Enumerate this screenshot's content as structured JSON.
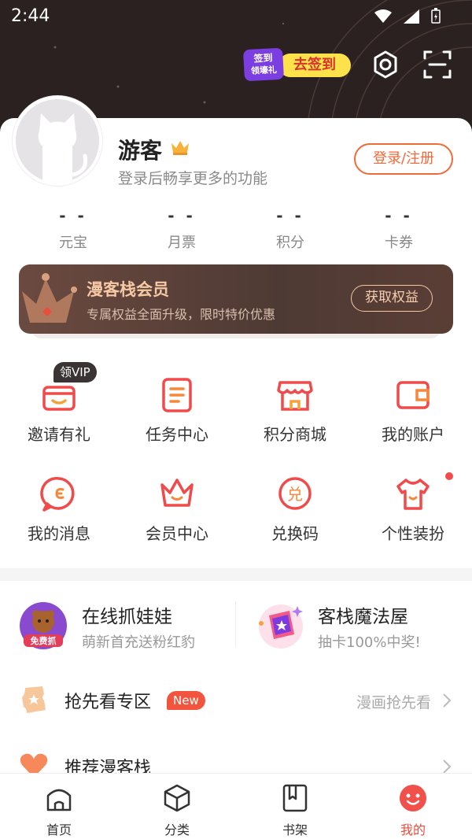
{
  "status_bar": {
    "time": "2:44"
  },
  "header": {
    "checkin_badge_line1": "签到",
    "checkin_badge_line2": "领壕礼",
    "checkin_button": "去签到"
  },
  "profile": {
    "username": "游客",
    "subtitle": "登录后畅享更多的功能",
    "login_button": "登录/注册"
  },
  "stats": [
    {
      "value": "- -",
      "label": "元宝"
    },
    {
      "value": "- -",
      "label": "月票"
    },
    {
      "value": "- -",
      "label": "积分"
    },
    {
      "value": "- -",
      "label": "卡券"
    }
  ],
  "vip_banner": {
    "title": "漫客栈会员",
    "description": "专属权益全面升级，限时特价优惠",
    "button": "获取权益"
  },
  "grid": {
    "row1": [
      {
        "label": "邀请有礼",
        "icon": "gift-box-icon",
        "tag": "领VIP"
      },
      {
        "label": "任务中心",
        "icon": "clipboard-icon"
      },
      {
        "label": "积分商城",
        "icon": "shop-icon"
      },
      {
        "label": "我的账户",
        "icon": "wallet-icon"
      }
    ],
    "row2": [
      {
        "label": "我的消息",
        "icon": "message-icon"
      },
      {
        "label": "会员中心",
        "icon": "crown-icon"
      },
      {
        "label": "兑换码",
        "icon": "redeem-icon",
        "glyph": "兑"
      },
      {
        "label": "个性装扮",
        "icon": "tshirt-icon"
      }
    ]
  },
  "promos": [
    {
      "title": "在线抓娃娃",
      "subtitle": "萌新首充送粉红豹",
      "image_label": "免费抓"
    },
    {
      "title": "客栈魔法屋",
      "subtitle": "抽卡100%中奖!"
    }
  ],
  "list": [
    {
      "title": "抢先看专区",
      "badge": "New",
      "right_text": "漫画抢先看"
    },
    {
      "title": "推荐漫客栈"
    }
  ],
  "tabbar": [
    {
      "label": "首页",
      "icon": "home-icon"
    },
    {
      "label": "分类",
      "icon": "box-icon"
    },
    {
      "label": "书架",
      "icon": "bookshelf-icon"
    },
    {
      "label": "我的",
      "icon": "profile-smile-icon",
      "active": true
    }
  ],
  "colors": {
    "accent": "#f06a3a",
    "header_bg": "#2b2121",
    "vip_gold": "#f6c9a4",
    "new_badge": "#f2543e"
  }
}
